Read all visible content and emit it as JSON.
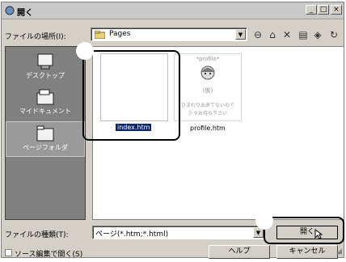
{
  "window": {
    "title": "開く",
    "minimize": "_",
    "maximize": "□",
    "close": "×"
  },
  "toolbar": {
    "lookin_label": "ファイルの場所(I):",
    "lookin_value": "Pages",
    "icons": [
      "back-icon",
      "up-folder-icon",
      "new-folder-icon",
      "delete-icon",
      "view-menu-icon",
      "tools-icon"
    ]
  },
  "places": [
    {
      "label": "デスクトップ",
      "icon": "desktop-icon"
    },
    {
      "label": "マイドキュメント",
      "icon": "my-documents-icon"
    },
    {
      "label": "ページフォルダ",
      "icon": "page-folder-icon"
    }
  ],
  "files": [
    {
      "name": "index.htm",
      "selected": true
    },
    {
      "name": "profile.htm",
      "selected": false,
      "thumb_lines": [
        "*profile*",
        "(仮)",
        "ひまわり出来てないので",
        "少々お待ち下さい"
      ]
    }
  ],
  "filetype": {
    "label": "ファイルの種類(T):",
    "value": "ページ(*.htm;*.html)"
  },
  "source_checkbox_label": "ソース編集で開く(S)",
  "buttons": {
    "open": "開く",
    "help": "ヘルプ",
    "cancel": "キャンセル"
  }
}
